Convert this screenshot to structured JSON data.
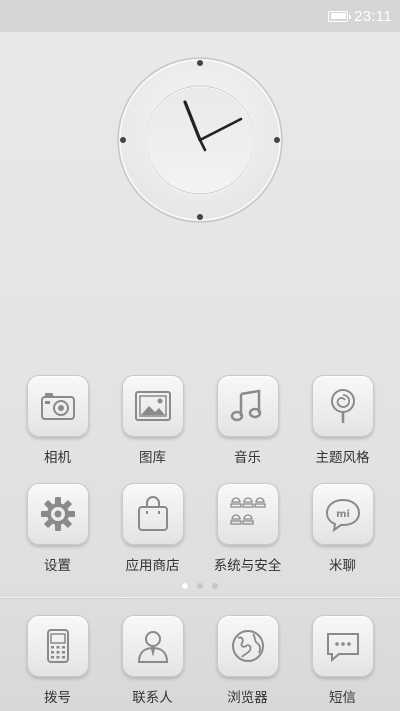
{
  "status_bar": {
    "time": "23:11",
    "battery": "full"
  },
  "clock": {
    "type": "analog",
    "hour_hand": "11",
    "minute_hand": "11"
  },
  "home_rows": [
    [
      {
        "label": "相机",
        "icon": "camera-icon"
      },
      {
        "label": "图库",
        "icon": "gallery-icon"
      },
      {
        "label": "音乐",
        "icon": "music-icon"
      },
      {
        "label": "主题风格",
        "icon": "theme-icon"
      }
    ],
    [
      {
        "label": "设置",
        "icon": "gear-icon"
      },
      {
        "label": "应用商店",
        "icon": "shopping-bag-icon"
      },
      {
        "label": "系统与安全",
        "icon": "folder-icon"
      },
      {
        "label": "米聊",
        "icon": "chat-bubble-icon"
      }
    ]
  ],
  "page_indicator": {
    "pages": 3,
    "current": 1
  },
  "dock": [
    {
      "label": "拨号",
      "icon": "phone-icon"
    },
    {
      "label": "联系人",
      "icon": "contact-icon"
    },
    {
      "label": "浏览器",
      "icon": "globe-icon"
    },
    {
      "label": "短信",
      "icon": "message-icon"
    }
  ],
  "colors": {
    "label": "#333333",
    "status_text": "#ffffff",
    "background": "#e6e6e6"
  }
}
